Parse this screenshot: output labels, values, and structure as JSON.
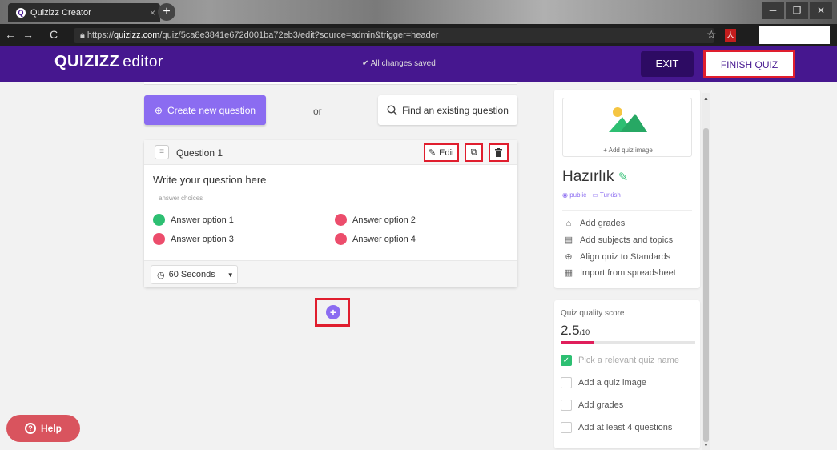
{
  "browser": {
    "tab_title": "Quizizz Creator",
    "favicon": "Q",
    "url_prefix": "https://",
    "url_domain": "quizizz.com",
    "url_path": "/quiz/5ca8e3841e672d001ba72eb3/edit?source=admin&trigger=header",
    "new_tab": "+",
    "tab_close": "×"
  },
  "header": {
    "logo": "QUIZIZZ",
    "logo_sub": "editor",
    "saved": "✔ All changes saved",
    "exit_label": "EXIT",
    "finish_label": "FINISH QUIZ",
    "bg_color": "#46178f"
  },
  "main": {
    "create_label": "Create new question",
    "or_label": "or",
    "find_label": "Find an existing question",
    "question": {
      "title": "Question 1",
      "edit_label": "Edit",
      "text": "Write your question here",
      "choices_label": "answer choices",
      "answers": [
        {
          "label": "Answer option 1",
          "color": "#2dbf72"
        },
        {
          "label": "Answer option 2",
          "color": "#ec4d6c"
        },
        {
          "label": "Answer option 3",
          "color": "#ec4d6c"
        },
        {
          "label": "Answer option 4",
          "color": "#ec4d6c"
        }
      ],
      "time_label": "60 Seconds"
    },
    "add_label": "+"
  },
  "help_label": "Help",
  "panel": {
    "add_image_label": "+ Add quiz image",
    "quiz_name": "Hazırlık",
    "visibility": "public",
    "language": "Turkish",
    "options": [
      {
        "icon": "graduation-cap-icon",
        "label": "Add grades"
      },
      {
        "icon": "book-icon",
        "label": "Add subjects and topics"
      },
      {
        "icon": "plus-circle-icon",
        "label": "Align quiz to Standards"
      },
      {
        "icon": "spreadsheet-icon",
        "label": "Import from spreadsheet"
      }
    ]
  },
  "quality": {
    "label": "Quiz quality score",
    "score": "2.5",
    "max": "/10",
    "fill_fraction": 0.25,
    "checklist": [
      {
        "label": "Pick a relevant quiz name",
        "done": true
      },
      {
        "label": "Add a quiz image",
        "done": false
      },
      {
        "label": "Add grades",
        "done": false
      },
      {
        "label": "Add at least 4 questions",
        "done": false
      }
    ]
  }
}
